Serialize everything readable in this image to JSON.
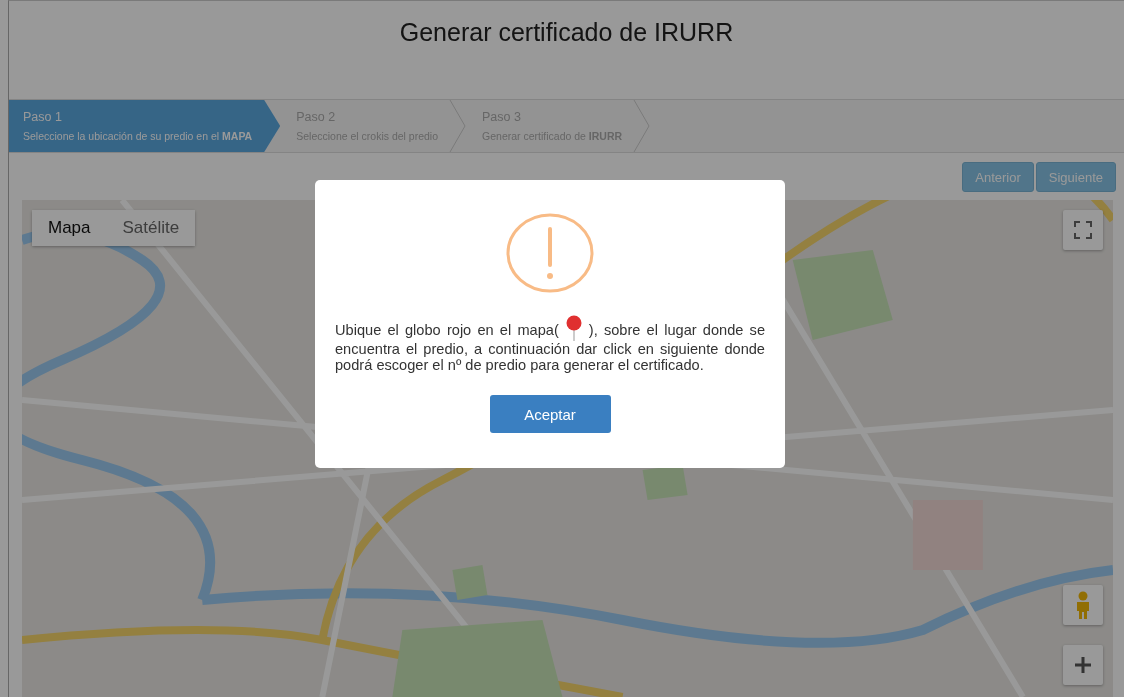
{
  "title": "Generar certificado de IRURR",
  "steps": [
    {
      "label": "Paso 1",
      "description": "Seleccione la ubicación de su predio en el **MAPA**",
      "selected": true
    },
    {
      "label": "Paso 2",
      "description": "Seleccione el crokis del predio",
      "selected": false
    },
    {
      "label": "Paso 3",
      "description": "Generar certificado de **IRURR**",
      "selected": false
    }
  ],
  "nav_buttons": [
    "Anterior",
    "Siguiente"
  ],
  "map": {
    "kind": "picture",
    "type_tabs": [
      {
        "label": "Mapa",
        "selected": true
      },
      {
        "label": "Satélite",
        "selected": false
      }
    ]
  },
  "dialog": {
    "message_before": "Ubique el globo rojo en el mapa(",
    "message_after": "), sobre el lugar donde se encuentra el predio, a continuación dar click en siguiente donde podrá escoger el nº de predio para generar el certificado.",
    "button": "Aceptar"
  }
}
